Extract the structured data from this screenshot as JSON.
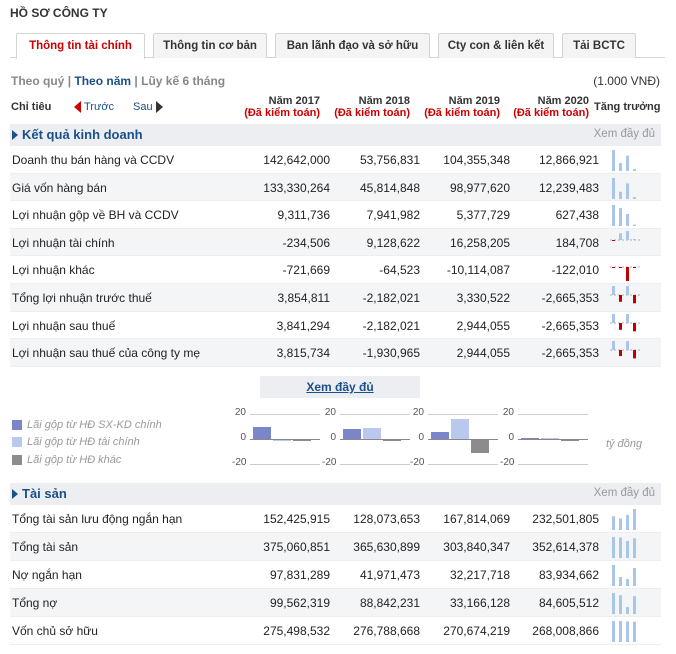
{
  "page_title": "HỒ SƠ CÔNG TY",
  "tabs": [
    "Thông tin tài chính",
    "Thông tin cơ bản",
    "Ban lãnh đạo và sở hữu",
    "Cty con & liên kết",
    "Tải BCTC"
  ],
  "filters": {
    "quarter": "Theo quý",
    "sep1": "|",
    "year": "Theo năm",
    "sep2": "|",
    "ytd": "Lũy kế 6 tháng"
  },
  "unit": "(1.000 VNĐ)",
  "header": {
    "chi_tieu": "Chỉ tiêu",
    "prev": "Trước",
    "next": "Sau",
    "growth": "Tăng trưởng",
    "years": [
      {
        "year": "Năm 2017",
        "note": "(Đã kiểm toán)"
      },
      {
        "year": "Năm 2018",
        "note": "(Đã kiểm toán)"
      },
      {
        "year": "Năm 2019",
        "note": "(Đã kiểm toán)"
      },
      {
        "year": "Năm 2020",
        "note": "(Đã kiểm toán)"
      }
    ]
  },
  "sections": {
    "kqkd": {
      "title": "Kết quả kinh doanh",
      "more": "Xem đầy đủ"
    },
    "tai_san": {
      "title": "Tài sản",
      "more": "Xem đầy đủ"
    }
  },
  "kqkd_rows": [
    {
      "name": "Doanh thu bán hàng và CCDV",
      "values": [
        "142,642,000",
        "53,756,831",
        "104,355,348",
        "12,866,921"
      ],
      "nums": [
        142642000,
        53756831,
        104355348,
        12866921
      ]
    },
    {
      "name": "Giá vốn hàng bán",
      "values": [
        "133,330,264",
        "45,814,848",
        "98,977,620",
        "12,239,483"
      ],
      "nums": [
        133330264,
        45814848,
        98977620,
        12239483
      ]
    },
    {
      "name": "Lợi nhuận gộp về BH và CCDV",
      "values": [
        "9,311,736",
        "7,941,982",
        "5,377,729",
        "627,438"
      ],
      "nums": [
        9311736,
        7941982,
        5377729,
        627438
      ]
    },
    {
      "name": "Lợi nhuận tài chính",
      "values": [
        "-234,506",
        "9,128,622",
        "16,258,205",
        "184,708"
      ],
      "nums": [
        -234506,
        9128622,
        16258205,
        184708
      ]
    },
    {
      "name": "Lợi nhuận khác",
      "values": [
        "-721,669",
        "-64,523",
        "-10,114,087",
        "-122,010"
      ],
      "nums": [
        -721669,
        -64523,
        -10114087,
        -122010
      ]
    },
    {
      "name": "Tổng lợi nhuận trước thuế",
      "values": [
        "3,854,811",
        "-2,182,021",
        "3,330,522",
        "-2,665,353"
      ],
      "nums": [
        3854811,
        -2182021,
        3330522,
        -2665353
      ]
    },
    {
      "name": "Lợi nhuận sau thuế",
      "values": [
        "3,841,294",
        "-2,182,021",
        "2,944,055",
        "-2,665,353"
      ],
      "nums": [
        3841294,
        -2182021,
        2944055,
        -2665353
      ]
    },
    {
      "name": "Lợi nhuận sau thuế của công ty mẹ",
      "values": [
        "3,815,734",
        "-1,930,965",
        "2,944,055",
        "-2,665,353"
      ],
      "nums": [
        3815734,
        -1930965,
        2944055,
        -2665353
      ]
    }
  ],
  "more_link": "Xem đầy đủ",
  "legend": [
    {
      "label": "Lãi gộp từ HĐ SX-KD chính",
      "color": "#7b86c8"
    },
    {
      "label": "Lãi gộp từ HĐ tài chính",
      "color": "#b9c8ec"
    },
    {
      "label": "Lãi gộp từ HĐ khác",
      "color": "#8c8c8c"
    }
  ],
  "mini_axis": {
    "top": "20",
    "mid": "0",
    "bottom": "-20"
  },
  "mini_unit": "tỷ đồng",
  "mini_charts": [
    {
      "values": [
        9.3,
        -0.2,
        -0.7
      ]
    },
    {
      "values": [
        7.9,
        9.1,
        -0.1
      ]
    },
    {
      "values": [
        5.4,
        16.3,
        -10.1
      ]
    },
    {
      "values": [
        0.6,
        0.2,
        -0.1
      ]
    }
  ],
  "ts_rows": [
    {
      "name": "Tổng tài sản lưu động ngắn hạn",
      "values": [
        "152,425,915",
        "128,073,653",
        "167,814,069",
        "232,501,805"
      ],
      "nums": [
        152425915,
        128073653,
        167814069,
        232501805
      ]
    },
    {
      "name": "Tổng tài sản",
      "values": [
        "375,060,851",
        "365,630,899",
        "303,840,347",
        "352,614,378"
      ],
      "nums": [
        375060851,
        365630899,
        303840347,
        352614378
      ]
    },
    {
      "name": "Nợ ngắn hạn",
      "values": [
        "97,831,289",
        "41,971,473",
        "32,217,718",
        "83,934,662"
      ],
      "nums": [
        97831289,
        41971473,
        32217718,
        83934662
      ]
    },
    {
      "name": "Tổng nợ",
      "values": [
        "99,562,319",
        "88,842,231",
        "33,166,128",
        "84,605,512"
      ],
      "nums": [
        99562319,
        88842231,
        33166128,
        84605512
      ]
    },
    {
      "name": "Vốn chủ sở hữu",
      "values": [
        "275,498,532",
        "276,788,668",
        "270,674,219",
        "268,008,866"
      ],
      "nums": [
        275498532,
        276788668,
        270674219,
        268008866
      ]
    }
  ],
  "colors": {
    "pos": "#a9c6ea",
    "neg": "#c00000",
    "accent": "#1a4f8a",
    "red": "#cc0000"
  }
}
